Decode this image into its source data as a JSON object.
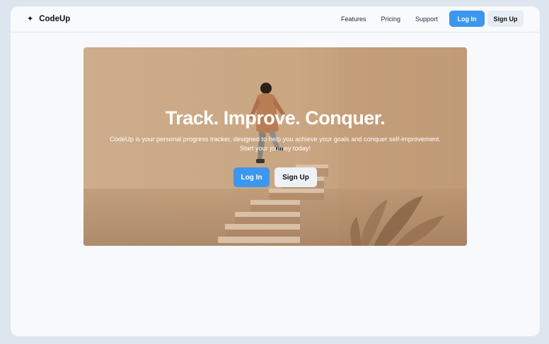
{
  "brand": {
    "icon": "sparkle-icon",
    "glyph": "✦",
    "name": "CodeUp"
  },
  "nav": {
    "links": [
      "Features",
      "Pricing",
      "Support"
    ],
    "login_label": "Log In",
    "signup_label": "Sign Up"
  },
  "hero": {
    "title": "Track. Improve. Conquer.",
    "subtitle_line1": "CodeUp is your personal progress tracker, designed to help you achieve your goals and conquer self-improvement.",
    "subtitle_line2": "Start your journey today!",
    "login_label": "Log In",
    "signup_label": "Sign Up",
    "image": "person-climbing-stairs-illustration"
  },
  "colors": {
    "accent": "#3d97ef",
    "page_background": "#dde6ef",
    "window_background": "#f7f9fc",
    "light_button": "#e7edf4"
  }
}
